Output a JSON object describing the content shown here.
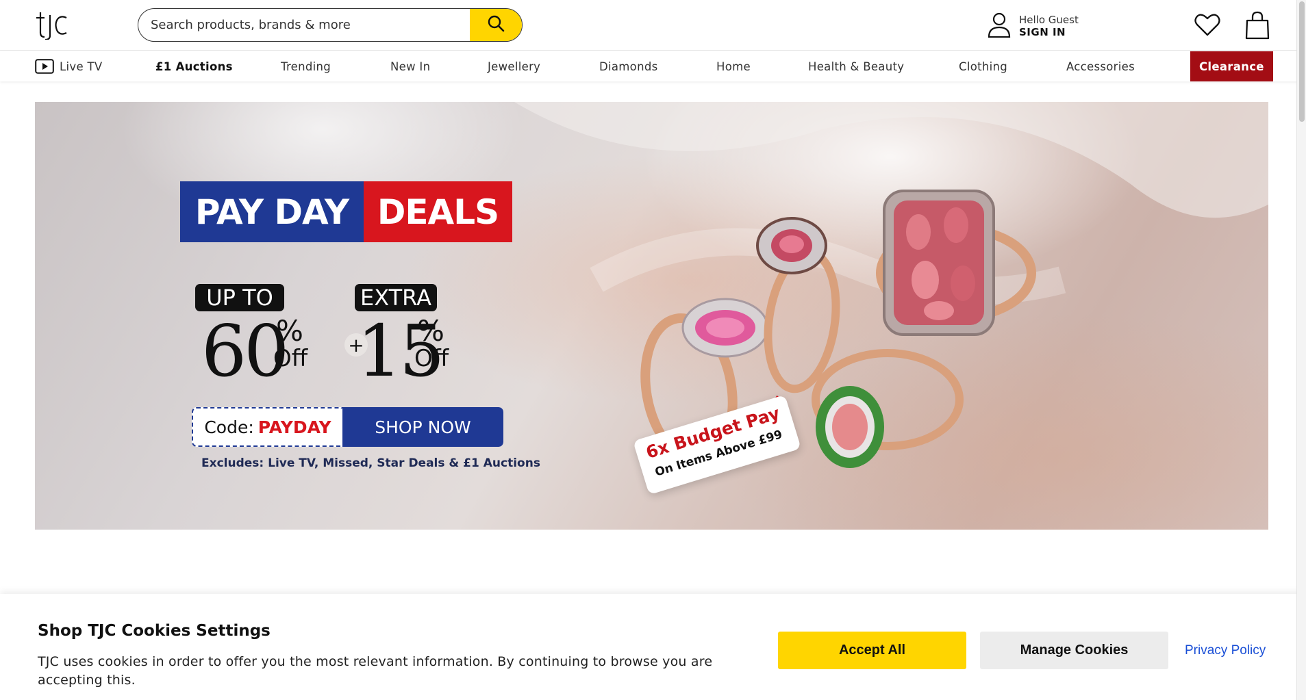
{
  "header": {
    "logo_text": "tjc",
    "search_placeholder": "Search products, brands & more",
    "account_greeting": "Hello Guest",
    "account_action": "SIGN IN"
  },
  "nav": {
    "items": [
      {
        "label": "Live TV"
      },
      {
        "label": "£1 Auctions"
      },
      {
        "label": "Trending"
      },
      {
        "label": "New In"
      },
      {
        "label": "Jewellery"
      },
      {
        "label": "Diamonds"
      },
      {
        "label": "Home"
      },
      {
        "label": "Health & Beauty"
      },
      {
        "label": "Clothing"
      },
      {
        "label": "Accessories"
      },
      {
        "label": "Clearance"
      }
    ]
  },
  "hero": {
    "ribbon_left": "PAY DAY",
    "ribbon_right": "DEALS",
    "pill_left": "UP TO",
    "pill_right": "EXTRA",
    "discount_main": "60",
    "discount_extra": "15",
    "percent_sign": "%",
    "off_text": "Off",
    "plus_sign": "+",
    "code_label": "Code:",
    "code_value": "PAYDAY",
    "shop_button": "SHOP NOW",
    "excludes": "Excludes: Live TV, Missed, Star Deals & £1 Auctions",
    "tag_line1": "6x Budget Pay",
    "tag_line2": "On Items Above £99"
  },
  "cookie_banner": {
    "title": "Shop TJC Cookies Settings",
    "message": "TJC uses cookies in order to offer you the most relevant information. By continuing to browse you are accepting this.",
    "accept_label": "Accept All",
    "manage_label": "Manage Cookies",
    "privacy_label": "Privacy Policy"
  },
  "colors": {
    "accent_yellow": "#ffd500",
    "clearance_red": "#a30d14",
    "hero_blue": "#1f3994",
    "hero_red": "#d8161e",
    "link_blue": "#1a4fd6"
  },
  "icons": [
    "tjc-logo",
    "search-icon",
    "user-icon",
    "heart-icon",
    "bag-icon",
    "play-icon"
  ]
}
